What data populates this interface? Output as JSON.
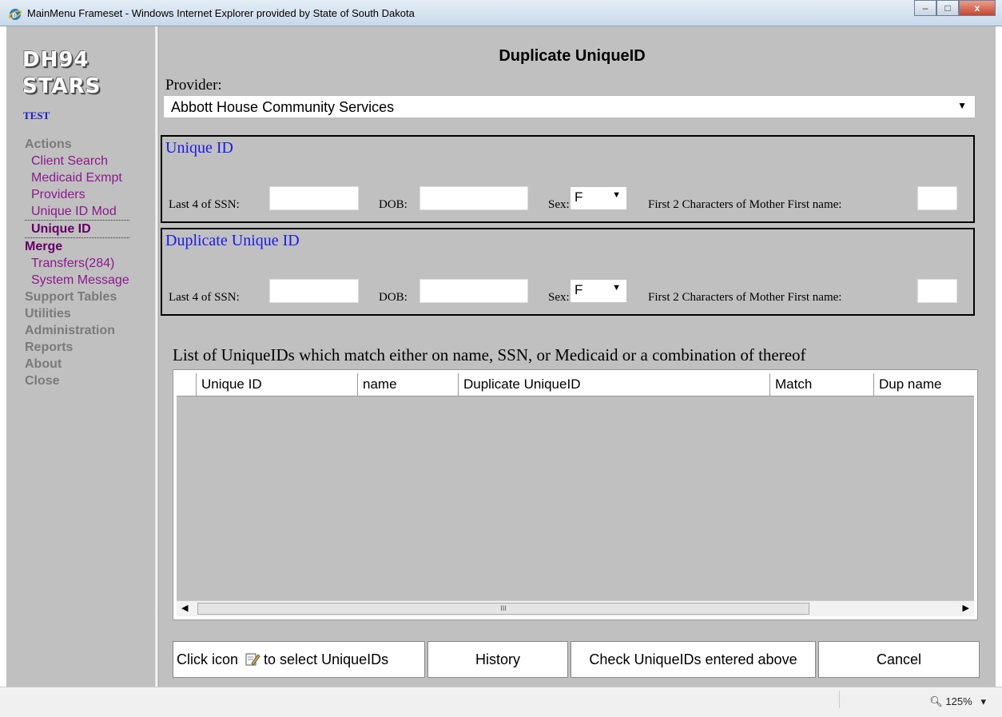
{
  "window": {
    "title": "MainMenu Frameset - Windows Internet Explorer provided by State of South Dakota",
    "min": "–",
    "max": "□",
    "close": "x"
  },
  "sidebar": {
    "logo_line1": "DH94",
    "logo_line2": "STARS",
    "env": "TEST",
    "sections": {
      "actions": "Actions",
      "client_search": "Client Search",
      "medicaid_exmpt": "Medicaid Exmpt",
      "providers": "Providers",
      "unique_id_mod": "Unique ID Mod",
      "unique_id": "Unique ID",
      "merge": "Merge",
      "transfers": "Transfers(284)",
      "system_message": "System Message",
      "support_tables": "Support Tables",
      "utilities": "Utilities",
      "administration": "Administration",
      "reports": "Reports",
      "about": "About",
      "close": "Close"
    }
  },
  "main": {
    "title": "Duplicate UniqueID",
    "provider_label": "Provider:",
    "provider_value": "Abbott House Community Services",
    "box1": {
      "legend": "Unique ID",
      "ssn_label": "Last 4 of SSN:",
      "dob_label": "DOB:",
      "sex_label": "Sex:",
      "sex_value": "F",
      "mother_label": "First 2 Characters of Mother First name:"
    },
    "box2": {
      "legend": "Duplicate Unique ID",
      "ssn_label": "Last 4 of SSN:",
      "dob_label": "DOB:",
      "sex_label": "Sex:",
      "sex_value": "F",
      "mother_label": "First 2 Characters of Mother First name:"
    },
    "list_caption": "List of UniqueIDs which match either on name, SSN, or Medicaid or a combination of thereof",
    "columns": [
      "Unique ID",
      "name",
      "Duplicate UniqueID",
      "Match",
      "Dup name"
    ],
    "scroll_grip": "III",
    "hint_prefix": "Click icon",
    "hint_suffix": "to select UniqueIDs",
    "buttons": {
      "history": "History",
      "check": "Check UniqueIDs entered above",
      "cancel": "Cancel"
    }
  },
  "statusbar": {
    "zoom": "125%"
  },
  "icons": {
    "browser": "ie-icon",
    "pick": "edit-pick-icon",
    "zoom": "zoom-icon"
  }
}
